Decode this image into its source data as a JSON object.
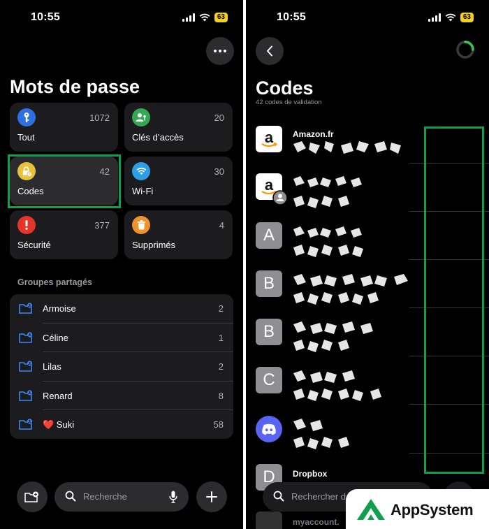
{
  "left": {
    "status": {
      "time": "10:55",
      "battery": "63"
    },
    "title": "Mots de passe",
    "tiles": [
      {
        "label": "Tout",
        "count": "1072",
        "color": "#2f6fe4"
      },
      {
        "label": "Clés d’accès",
        "count": "20",
        "color": "#34a853"
      },
      {
        "label": "Codes",
        "count": "42",
        "color": "#e8c23a"
      },
      {
        "label": "Wi-Fi",
        "count": "30",
        "color": "#2d9ee8"
      },
      {
        "label": "Sécurité",
        "count": "377",
        "color": "#e5352b"
      },
      {
        "label": "Supprimés",
        "count": "4",
        "color": "#f0922c"
      }
    ],
    "groups_label": "Groupes partagés",
    "groups": [
      {
        "name": "Armoise",
        "count": "2"
      },
      {
        "name": "Céline",
        "count": "1"
      },
      {
        "name": "Lilas",
        "count": "2"
      },
      {
        "name": "Renard",
        "count": "8"
      },
      {
        "name": "❤️ Suki",
        "count": "58"
      }
    ],
    "search_placeholder": "Recherche"
  },
  "right": {
    "status": {
      "time": "10:55",
      "battery": "63"
    },
    "title": "Codes",
    "subtitle": "42 codes de validation",
    "rows": [
      {
        "icon": "amazon-icon",
        "title": "Amazon.fr"
      },
      {
        "icon": "amazon-shared-icon",
        "title": ""
      },
      {
        "icon": "letter-icon",
        "letter": "A",
        "title": ""
      },
      {
        "icon": "letter-icon",
        "letter": "B",
        "title": ""
      },
      {
        "icon": "letter-icon",
        "letter": "B",
        "title": ""
      },
      {
        "icon": "letter-icon",
        "letter": "C",
        "title": ""
      },
      {
        "icon": "discord-icon",
        "title": ""
      },
      {
        "icon": "letter-icon",
        "letter": "D",
        "title": "Dropbox"
      }
    ],
    "partial_next_title": "myaccount.",
    "search_placeholder": "Rechercher d"
  },
  "watermark": {
    "text": "AppSystem",
    "color": "#0ca14a"
  }
}
